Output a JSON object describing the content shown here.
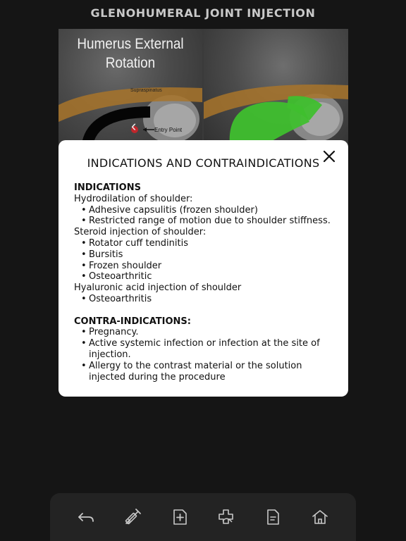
{
  "app_title": "GLENOHUMERAL JOINT INJECTION",
  "viewer": {
    "caption_line1": "Humerus External",
    "caption_line2": "Rotation",
    "structure_label": "Supraspinatus",
    "entry_label": "Entry Point",
    "overlay_color": "#3fbf2e",
    "muscle_color": "#a8742a",
    "needle_marker_color": "#c0262b"
  },
  "modal": {
    "title": "INDICATIONS AND CONTRAINDICATIONS",
    "close_icon": "close-icon",
    "indications_heading": "INDICATIONS",
    "hydrodilation_label": "Hydrodilation of shoulder:",
    "hydrodilation_items": [
      "Adhesive capsulitis (frozen shoulder)",
      "Restricted range of motion due to shoulder stiffness."
    ],
    "steroid_label": "Steroid injection of shoulder:",
    "steroid_items": [
      "Rotator cuff tendinitis",
      "Bursitis",
      "Frozen shoulder",
      "Osteoarthritic"
    ],
    "hyaluronic_label": "Hyaluronic acid injection of shoulder",
    "hyaluronic_items": [
      "Osteoarthritis"
    ],
    "contra_heading": "CONTRA-INDICATIONS:",
    "contra_items": [
      "Pregnancy.",
      "Active systemic infection or infection at the site of injection.",
      "Allergy to the contrast material or the solution injected during the procedure"
    ],
    "bullet_char": "•"
  },
  "toolbar": {
    "icons": [
      "back-arrow-icon",
      "syringe-icon",
      "add-document-icon",
      "medical-bandage-icon",
      "document-icon",
      "home-icon"
    ]
  },
  "colors": {
    "background": "#151515",
    "toolbar": "#232323",
    "modal": "#ffffff",
    "title": "#c9c9c9",
    "icon": "#c8c8c8"
  }
}
